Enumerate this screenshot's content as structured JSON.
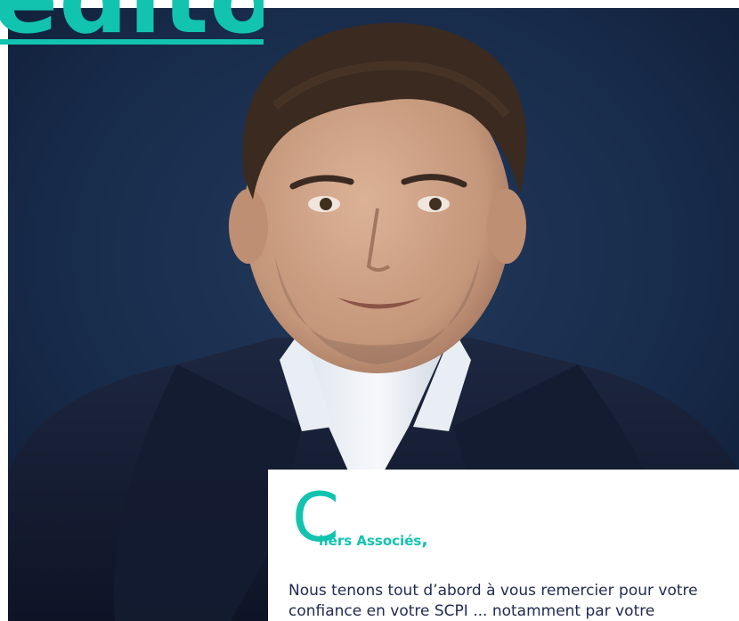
{
  "header": {
    "title": "edito"
  },
  "letter": {
    "dropcap": "C",
    "salutation_rest": "hers Associés",
    "salutation_comma": ",",
    "body_line_1": "Nous tenons tout d’abord à vous remercier pour votre",
    "body_line_2": "confiance en votre SCPI ... notamment par votre souscription..."
  },
  "colors": {
    "accent": "#12c3b0",
    "background_photo": "#17294a",
    "body_text": "#222a52"
  }
}
